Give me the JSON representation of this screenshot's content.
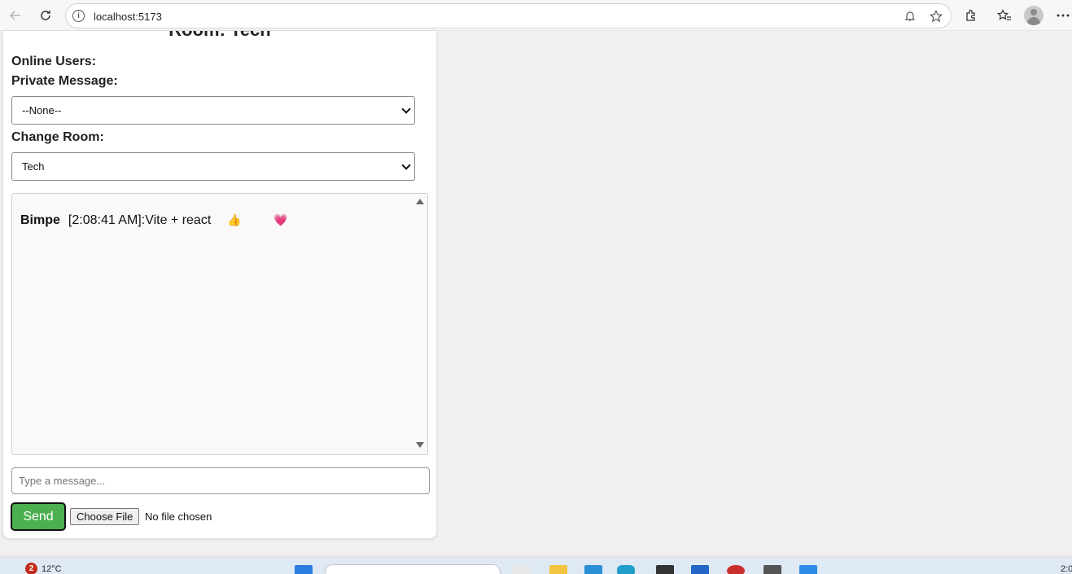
{
  "browser": {
    "url": "localhost:5173"
  },
  "chat": {
    "room_heading": "Room: Tech",
    "online_users_label": "Online Users:",
    "private_message_label": "Private Message:",
    "private_message_selected": "--None--",
    "change_room_label": "Change Room:",
    "room_selected": "Tech",
    "messages": [
      {
        "sender": "Bimpe",
        "text": "[2:08:41 AM]:Vite + react",
        "reactions": [
          "👍",
          "💗"
        ]
      }
    ],
    "input_placeholder": "Type a message...",
    "send_label": "Send",
    "choose_file_label": "Choose File",
    "file_status": "No file chosen"
  },
  "taskbar": {
    "weather_badge": "2",
    "temperature": "12°C",
    "clock": "2:0"
  },
  "colors": {
    "send_button": "#4caf50",
    "weather_badge": "#c42b1c",
    "taskbar": "#dfe9f5"
  }
}
